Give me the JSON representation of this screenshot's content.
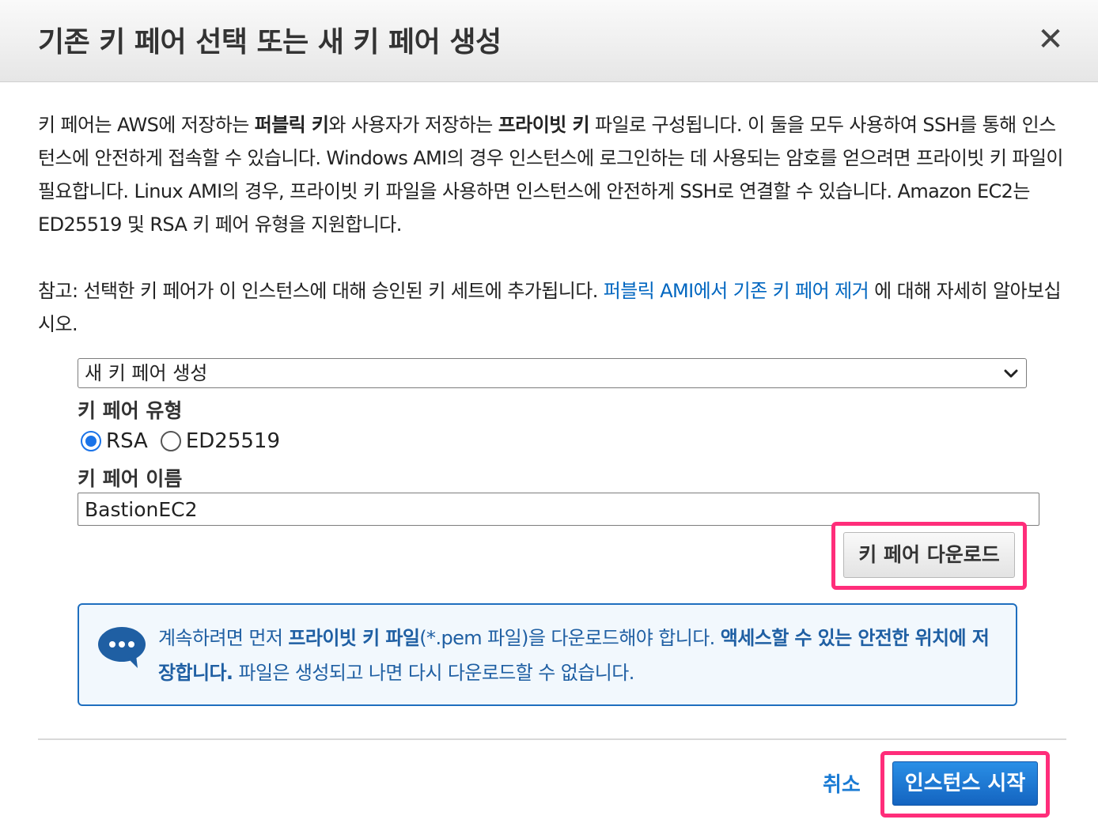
{
  "dialog": {
    "title": "기존 키 페어 선택 또는 새 키 페어 생성",
    "close_glyph": "✕"
  },
  "description": {
    "seg1": "키 페어는 AWS에 저장하는 ",
    "bold1": "퍼블릭 키",
    "seg2": "와 사용자가 저장하는 ",
    "bold2": "프라이빗 키",
    "seg3": " 파일로 구성됩니다. 이 둘을 모두 사용하여 SSH를 통해 인스턴스에 안전하게 접속할 수 있습니다. Windows AMI의 경우 인스턴스에 로그인하는 데 사용되는 암호를 얻으려면 프라이빗 키 파일이 필요합니다. Linux AMI의 경우, 프라이빗 키 파일을 사용하면 인스턴스에 안전하게 SSH로 연결할 수 있습니다. Amazon EC2는 ED25519 및 RSA 키 페어 유형을 지원합니다."
  },
  "note": {
    "prefix": "참고: 선택한 키 페어가 이 인스턴스에 대해 승인된 키 세트에 추가됩니다. ",
    "link": "퍼블릭 AMI에서 기존 키 페어 제거",
    "suffix": " 에 대해 자세히 알아보십시오."
  },
  "key_pair_select": {
    "selected": "새 키 페어 생성"
  },
  "key_type": {
    "label": "키 페어 유형",
    "options": [
      {
        "label": "RSA",
        "selected": true
      },
      {
        "label": "ED25519",
        "selected": false
      }
    ]
  },
  "key_name": {
    "label": "키 페어 이름",
    "value": "BastionEC2"
  },
  "download_button": "키 페어 다운로드",
  "info": {
    "seg1": "계속하려면 먼저 ",
    "bold1": "프라이빗 키 파일",
    "seg2": "(*.pem 파일)을 다운로드해야 합니다. ",
    "bold2": "액세스할 수 있는 안전한 위치에 저장합니다.",
    "seg3": " 파일은 생성되고 나면 다시 다운로드할 수 없습니다."
  },
  "footer": {
    "cancel": "취소",
    "launch": "인스턴스 시작"
  },
  "colors": {
    "accent": "#1a73e8",
    "highlight": "#ff2d7a",
    "link": "#0066c0"
  }
}
